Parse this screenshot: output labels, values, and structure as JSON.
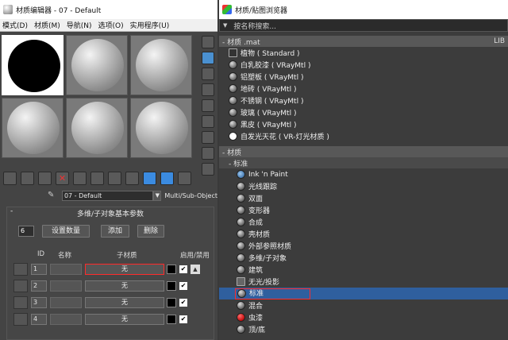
{
  "editor": {
    "title": "材质编辑器 - 07 - Default",
    "menu": [
      "模式(D)",
      "材质(M)",
      "导航(N)",
      "选项(O)",
      "实用程序(U)"
    ],
    "material_name": "07 - Default",
    "material_type": "Multi/Sub-Object",
    "rollout_title": "多维/子对象基本参数",
    "count": "6",
    "set_count_label": "设置数量",
    "add_label": "添加",
    "delete_label": "删除",
    "columns": {
      "id": "ID",
      "name": "名称",
      "submat": "子材质",
      "toggle": "启用/禁用"
    },
    "rows": [
      {
        "id": "1",
        "submat": "无"
      },
      {
        "id": "2",
        "submat": "无"
      },
      {
        "id": "3",
        "submat": "无"
      },
      {
        "id": "4",
        "submat": "无"
      }
    ],
    "check_mark": "✔",
    "up_arrow": "▲",
    "rollout_toggle": "-"
  },
  "browser": {
    "title": "材质/贴图浏览器",
    "search_placeholder": "按名称搜索...",
    "tri": "▼",
    "scene_group": "- 材质 .mat",
    "scene_group_right": "LIB",
    "scene_items": [
      "植物  ( Standard )",
      "白乳胶漆  ( VRayMtl )",
      "铝塑板  ( VRayMtl )",
      "地砖  ( VRayMtl )",
      "不锈钢  ( VRayMtl )",
      "玻璃  ( VRayMtl )",
      "黑皮  ( VRayMtl )",
      "自发光天花  ( VR-灯光材质 )"
    ],
    "materials_group": "- 材质",
    "standard_group": "- 标准",
    "materials": [
      "Ink 'n Paint",
      "光线跟踪",
      "双面",
      "变形器",
      "合成",
      "壳材质",
      "外部参照材质",
      "多维/子对象",
      "建筑",
      "无光/投影",
      "标准",
      "混合",
      "虫漆",
      "顶/底"
    ]
  },
  "colors": {
    "selection": "#2f5f9e",
    "highlight": "#ff2a2a",
    "accent_tool": "#3b8be0"
  }
}
